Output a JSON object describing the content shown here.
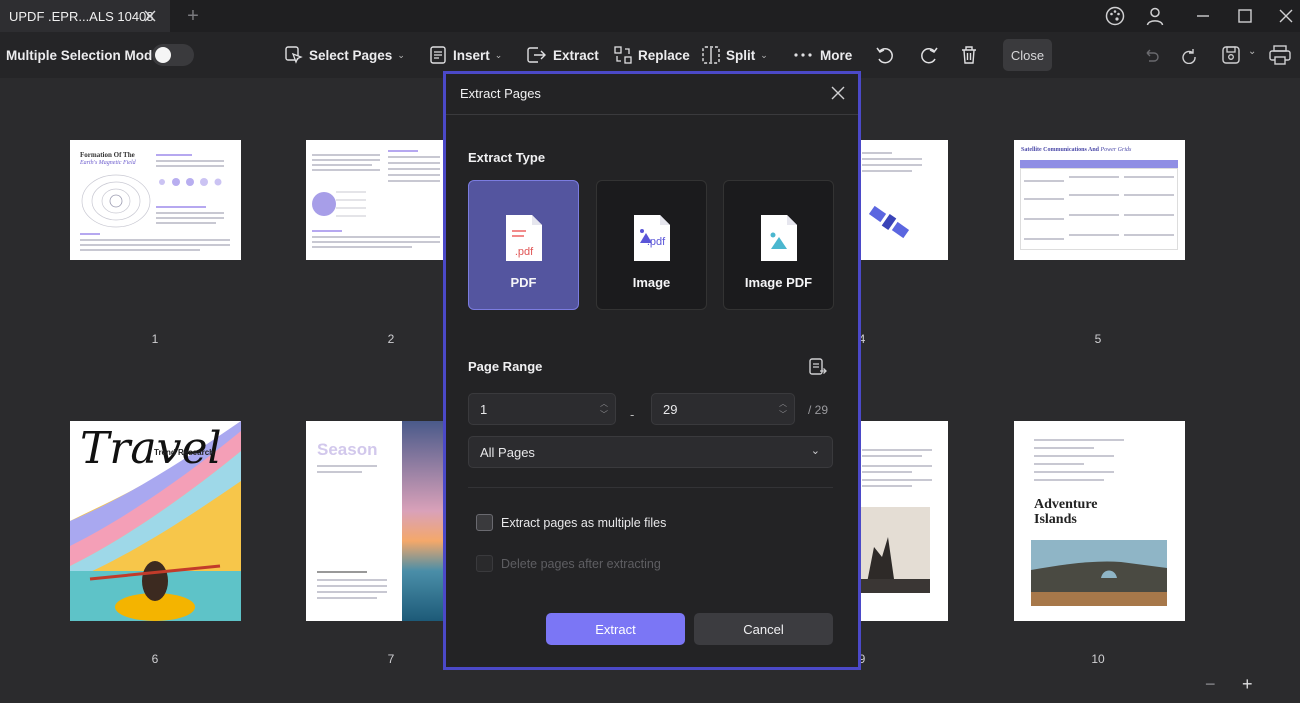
{
  "window": {
    "tab_title": "UPDF .EPR...ALS 10408",
    "new_tab_symbol": "+"
  },
  "toolbar": {
    "multi_select_label": "Multiple Selection Mode",
    "select_pages_label": "Select Pages",
    "insert_label": "Insert",
    "extract_label": "Extract",
    "replace_label": "Replace",
    "split_label": "Split",
    "more_label": "More",
    "close_label": "Close"
  },
  "pages": [
    {
      "number": "1",
      "title": "Formation Of The",
      "subtitle": "Earth's Magnetic Field"
    },
    {
      "number": "2"
    },
    {
      "number": "4"
    },
    {
      "number": "5",
      "title": "Satellite Communications And",
      "subtitle": "Power Grids"
    },
    {
      "number": "6",
      "title": "Travel",
      "subtitle": "Trend Research"
    },
    {
      "number": "7",
      "title": "Season"
    },
    {
      "number": "9"
    },
    {
      "number": "10",
      "title": "Adventure Islands"
    }
  ],
  "dialog": {
    "title": "Extract Pages",
    "extract_type_label": "Extract Type",
    "types": [
      {
        "label": "PDF",
        "icon_text": ".pdf",
        "selected": true
      },
      {
        "label": "Image",
        "icon_text": ".pdf",
        "selected": false
      },
      {
        "label": "Image PDF",
        "icon_text": "",
        "selected": false
      }
    ],
    "page_range_label": "Page Range",
    "range_from": "1",
    "range_to": "29",
    "range_total": "/ 29",
    "range_dash": "-",
    "range_select": "All Pages",
    "option_multiple_files": "Extract pages as multiple files",
    "option_delete_pages": "Delete pages after extracting",
    "extract_button": "Extract",
    "cancel_button": "Cancel"
  },
  "zoom": {
    "minus": "−",
    "plus": "+"
  },
  "colors": {
    "accent": "#7b76f5",
    "selected_card": "#54559f",
    "dialog_border": "#4b49c8",
    "background": "#2b2b2d"
  }
}
